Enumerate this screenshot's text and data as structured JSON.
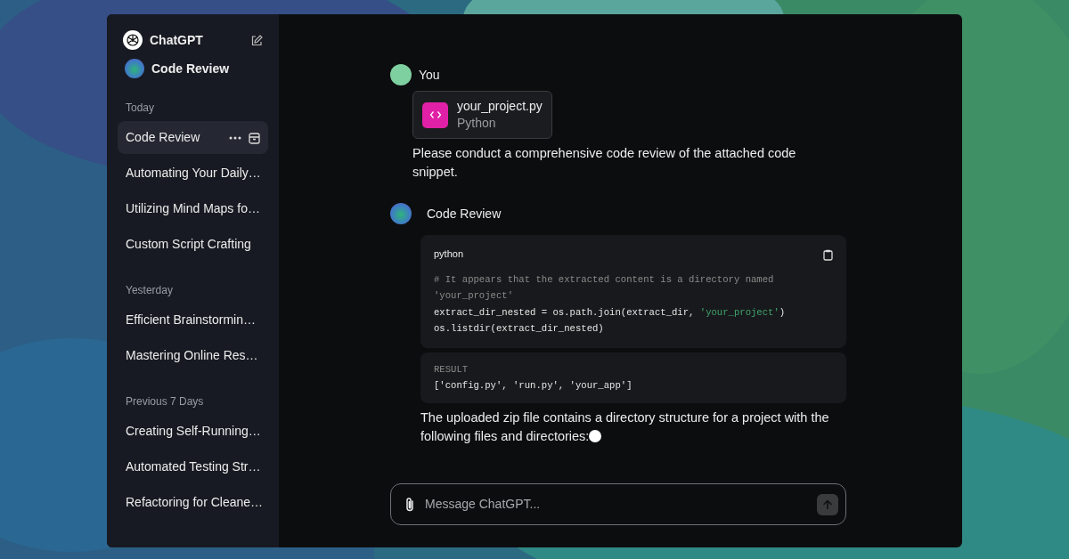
{
  "sidebar": {
    "app_name": "ChatGPT",
    "gpt": {
      "name": "Code Review"
    },
    "sections": [
      {
        "heading": "Today",
        "items": [
          {
            "title": "Code Review",
            "selected": true
          },
          {
            "title": "Automating Your Daily…",
            "selected": false
          },
          {
            "title": "Utilizing Mind Maps fo…",
            "selected": false
          },
          {
            "title": "Custom Script Crafting",
            "selected": false
          }
        ]
      },
      {
        "heading": "Yesterday",
        "items": [
          {
            "title": "Efficient Brainstormin…",
            "selected": false
          },
          {
            "title": "Mastering Online Res…",
            "selected": false
          }
        ]
      },
      {
        "heading": "Previous 7 Days",
        "items": [
          {
            "title": "Creating Self-Running…",
            "selected": false
          },
          {
            "title": "Automated Testing Str…",
            "selected": false
          },
          {
            "title": "Refactoring for Cleane…",
            "selected": false
          }
        ]
      }
    ]
  },
  "messages": [
    {
      "kind": "user",
      "author": "You",
      "attachment": {
        "filename": "your_project.py",
        "filetype": "Python"
      },
      "text": "Please conduct a comprehensive code review of the attached code snippet."
    },
    {
      "kind": "assistant",
      "author": "Code Review",
      "code": {
        "language": "python",
        "lines": [
          [
            {
              "kind": "comment",
              "text": "# It appears that the extracted content is a directory named"
            }
          ],
          [
            {
              "kind": "comment",
              "text": "'your_project'"
            }
          ],
          [
            {
              "kind": "plain",
              "text": "extract_dir_nested = os.path.join(extract_dir, "
            },
            {
              "kind": "string",
              "text": "'your_project'"
            },
            {
              "kind": "plain",
              "text": ")"
            }
          ],
          [
            {
              "kind": "plain",
              "text": "os.listdir(extract_dir_nested)"
            }
          ]
        ]
      },
      "result": {
        "label": "RESULT",
        "text": "['config.py', 'run.py', 'your_app']"
      },
      "text": "The uploaded zip file contains a directory structure for a project with the following files and directories:",
      "streaming": true
    }
  ],
  "composer": {
    "placeholder": "Message ChatGPT..."
  }
}
